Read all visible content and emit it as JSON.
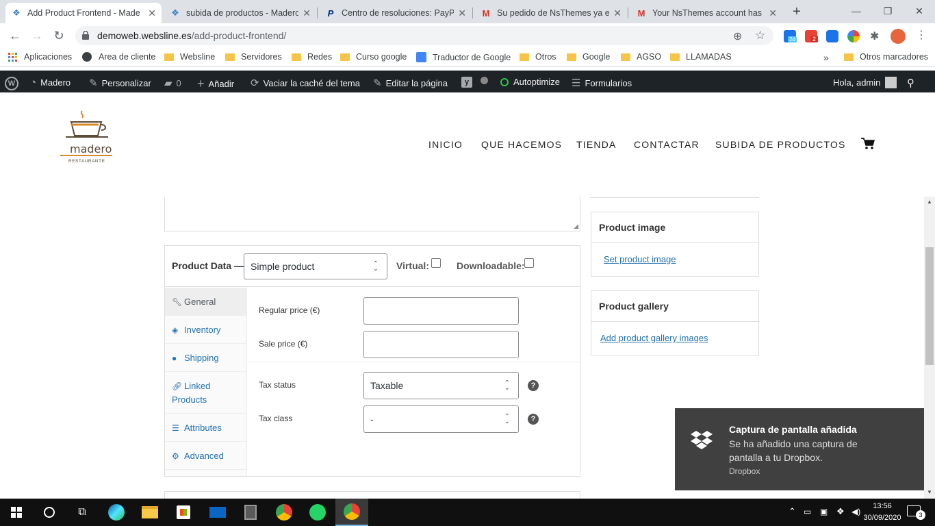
{
  "browser": {
    "tabs": [
      {
        "title": "Add Product Frontend - Made",
        "active": true,
        "favicon": "wordpress-favicon"
      },
      {
        "title": "subida de productos - Madero",
        "active": false,
        "favicon": "wordpress-favicon"
      },
      {
        "title": "Centro de resoluciones: PayPal",
        "active": false,
        "favicon": "paypal-favicon"
      },
      {
        "title": "Su pedido de NsThemes ya est",
        "active": false,
        "favicon": "gmail-favicon"
      },
      {
        "title": "Your NsThemes account has b",
        "active": false,
        "favicon": "gmail-favicon"
      }
    ],
    "url_host": "demoweb.websline.es",
    "url_path": "/add-product-frontend/",
    "extension_badges": {
      "calendar": "2d",
      "mail": "2"
    },
    "bookmarks": [
      "Aplicaciones",
      "Area de cliente",
      "Websline",
      "Servidores",
      "Redes",
      "Curso google",
      "Traductor de Google",
      "Otros",
      "Google",
      "AGSO",
      "LLAMADAS"
    ],
    "bookmarks_more": "»",
    "other_bookmarks": "Otros marcadores"
  },
  "adminbar": {
    "site": "Madero",
    "customize": "Personalizar",
    "comments": "0",
    "add": "Añadir",
    "cache": "Vaciar la caché del tema",
    "edit": "Editar la página",
    "autoptimize": "Autoptimize",
    "forms": "Formularios",
    "greeting": "Hola, admin"
  },
  "site": {
    "logo_text": "madero",
    "logo_subtext": "RESTAURANTE",
    "nav": [
      "INICIO",
      "QUE HACEMOS",
      "TIENDA",
      "CONTACTAR",
      "SUBIDA DE PRODUCTOS"
    ]
  },
  "product_data": {
    "label": "Product Data —",
    "type_value": "Simple product",
    "virtual_label": "Virtual:",
    "downloadable_label": "Downloadable:",
    "tabs": [
      {
        "label": "General",
        "icon": "wrench-icon",
        "active": true
      },
      {
        "label": "Inventory",
        "icon": "tag-icon",
        "active": false
      },
      {
        "label": "Shipping",
        "icon": "globe-icon",
        "active": false
      },
      {
        "label": "Linked Products",
        "icon": "link-icon",
        "active": false
      },
      {
        "label": "Attributes",
        "icon": "list-icon",
        "active": false
      },
      {
        "label": "Advanced",
        "icon": "gear-icon",
        "active": false
      }
    ],
    "fields": {
      "regular_price_label": "Regular price (€)",
      "sale_price_label": "Sale price (€)",
      "tax_status_label": "Tax status",
      "tax_status_value": "Taxable",
      "tax_class_label": "Tax class",
      "tax_class_value": "-",
      "help": "?"
    }
  },
  "sidebar": {
    "product_image_title": "Product image",
    "product_image_link": "Set product image",
    "product_gallery_title": "Product gallery",
    "product_gallery_link": "Add product gallery images"
  },
  "toast": {
    "title": "Captura de pantalla añadida",
    "body": "Se ha añadido una captura de pantalla a tu Dropbox.",
    "source": "Dropbox"
  },
  "taskbar": {
    "time": "13:56",
    "date": "30/09/2020",
    "notifications": "3"
  }
}
